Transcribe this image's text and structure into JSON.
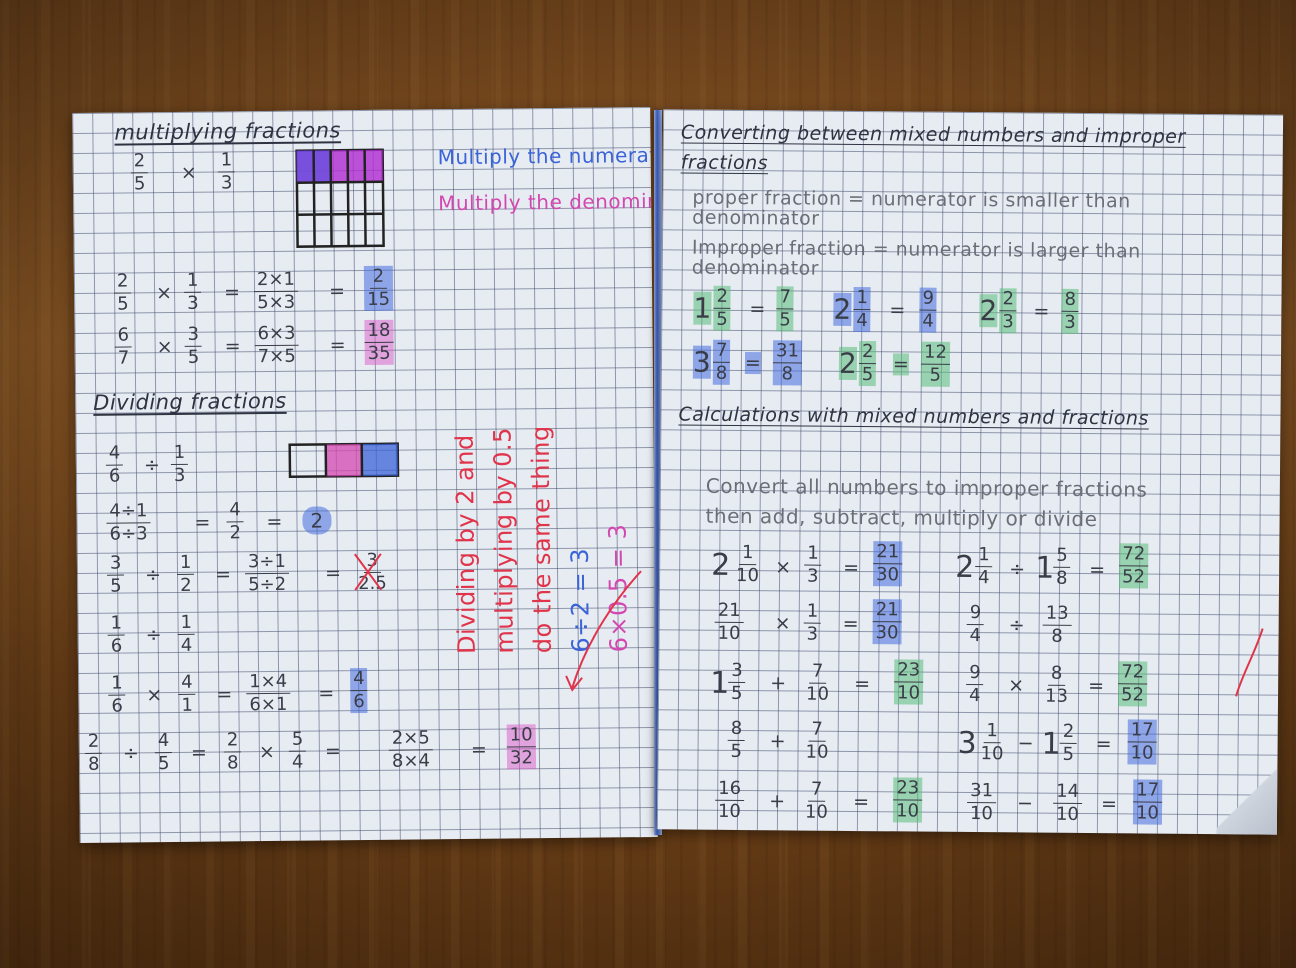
{
  "left_page": {
    "title_multiplying": "multiplying fractions",
    "multiply_note_1": "Multiply the numerators.",
    "multiply_note_2": "Multiply the denominators",
    "title_dividing": "Dividing fractions",
    "vertical_note_line1": "Dividing by 2 and",
    "vertical_note_line2": "multiplying by 0.5",
    "vertical_note_line3": "do the same thing",
    "vertical_note_eq1": "6÷2 = 3",
    "vertical_note_eq2": "6×0.5 = 3",
    "ops": {
      "times": "×",
      "divide": "÷",
      "equals": "="
    },
    "fractions": {
      "f2_5": {
        "n": "2",
        "d": "5"
      },
      "f1_3": {
        "n": "1",
        "d": "3"
      },
      "f2x1_5x3": {
        "n": "2×1",
        "d": "5×3"
      },
      "f2_15": {
        "n": "2",
        "d": "15"
      },
      "f6_7": {
        "n": "6",
        "d": "7"
      },
      "f3_5": {
        "n": "3",
        "d": "5"
      },
      "f6x3_7x5": {
        "n": "6×3",
        "d": "7×5"
      },
      "f18_35": {
        "n": "18",
        "d": "35"
      },
      "f4_6": {
        "n": "4",
        "d": "6"
      },
      "f4d1_6d3": {
        "n": "4÷1",
        "d": "6÷3"
      },
      "f4_2": {
        "n": "4",
        "d": "2"
      },
      "w2": "2",
      "f3_5b": {
        "n": "3",
        "d": "5"
      },
      "f1_2": {
        "n": "1",
        "d": "2"
      },
      "f3d1_5d2": {
        "n": "3÷1",
        "d": "5÷2"
      },
      "f3_25": {
        "n": "3",
        "d": "2.5"
      },
      "f1_6": {
        "n": "1",
        "d": "6"
      },
      "f1_4": {
        "n": "1",
        "d": "4"
      },
      "f4_1": {
        "n": "4",
        "d": "1"
      },
      "f1x4_6x1": {
        "n": "1×4",
        "d": "6×1"
      },
      "f4_6b": {
        "n": "4",
        "d": "6"
      },
      "f2_8": {
        "n": "2",
        "d": "8"
      },
      "f4_5": {
        "n": "4",
        "d": "5"
      },
      "f5_4": {
        "n": "5",
        "d": "4"
      },
      "f2x5_8x4": {
        "n": "2×5",
        "d": "8×4"
      },
      "f10_32": {
        "n": "10",
        "d": "32"
      }
    }
  },
  "right_page": {
    "title_converting": "Converting between mixed numbers and improper fractions",
    "def_proper": "proper fraction = numerator is smaller than denominator",
    "def_improper": "Improper fraction = numerator is larger than denominator",
    "title_calculations": "Calculations with mixed numbers and fractions",
    "instruction_1": "Convert all numbers to improper fractions",
    "instruction_2": "then add, subtract, multiply or divide",
    "ops": {
      "times": "×",
      "divide": "÷",
      "equals": "=",
      "plus": "+",
      "minus": "−"
    },
    "mixed": {
      "m1_2_5": {
        "w": "1",
        "n": "2",
        "d": "5"
      },
      "i7_5": {
        "n": "7",
        "d": "5"
      },
      "m2_1_4": {
        "w": "2",
        "n": "1",
        "d": "4"
      },
      "i9_4": {
        "n": "9",
        "d": "4"
      },
      "m2_2_3": {
        "w": "2",
        "n": "2",
        "d": "3"
      },
      "i8_3": {
        "n": "8",
        "d": "3"
      },
      "m3_7_8": {
        "w": "3",
        "n": "7",
        "d": "8"
      },
      "i31_8": {
        "n": "31",
        "d": "8"
      },
      "m2_2_5": {
        "w": "2",
        "n": "2",
        "d": "5"
      },
      "i12_5": {
        "n": "12",
        "d": "5"
      },
      "c_m2_1_10": {
        "w": "2",
        "n": "1",
        "d": "10"
      },
      "c_1_3": {
        "n": "1",
        "d": "3"
      },
      "c_21_30": {
        "n": "21",
        "d": "30"
      },
      "c_m2_1_4": {
        "w": "2",
        "n": "1",
        "d": "4"
      },
      "c_m1_5_8": {
        "w": "1",
        "n": "5",
        "d": "8"
      },
      "c_72_52": {
        "n": "72",
        "d": "52"
      },
      "c_21_10": {
        "n": "21",
        "d": "10"
      },
      "c_9_4": {
        "n": "9",
        "d": "4"
      },
      "c_13_8": {
        "n": "13",
        "d": "8"
      },
      "c_m1_3_5": {
        "w": "1",
        "n": "3",
        "d": "5"
      },
      "c_7_10": {
        "n": "7",
        "d": "10"
      },
      "c_23_10": {
        "n": "23",
        "d": "10"
      },
      "c_8_13": {
        "n": "8",
        "d": "13"
      },
      "c_8_5": {
        "n": "8",
        "d": "5"
      },
      "c_m3_1_10": {
        "w": "3",
        "n": "1",
        "d": "10"
      },
      "c_m1_2_5": {
        "w": "1",
        "n": "2",
        "d": "5"
      },
      "c_17_10": {
        "n": "17",
        "d": "10"
      },
      "c_16_10": {
        "n": "16",
        "d": "10"
      },
      "c_23_10b": {
        "n": "23",
        "d": "10"
      },
      "c_31_10": {
        "n": "31",
        "d": "10"
      },
      "c_14_10": {
        "n": "14",
        "d": "10"
      },
      "c_17_10b": {
        "n": "17",
        "d": "10"
      }
    }
  },
  "colors": {
    "blue_ink": "#3a63d8",
    "pink_ink": "#d447b0",
    "red_ink": "#e0344a",
    "highlight_blue": "#466edc",
    "highlight_green": "#5abe78",
    "highlight_pink": "#dc5ac8",
    "wood": "#7a4a1e",
    "spine": "#3a5ec0"
  }
}
